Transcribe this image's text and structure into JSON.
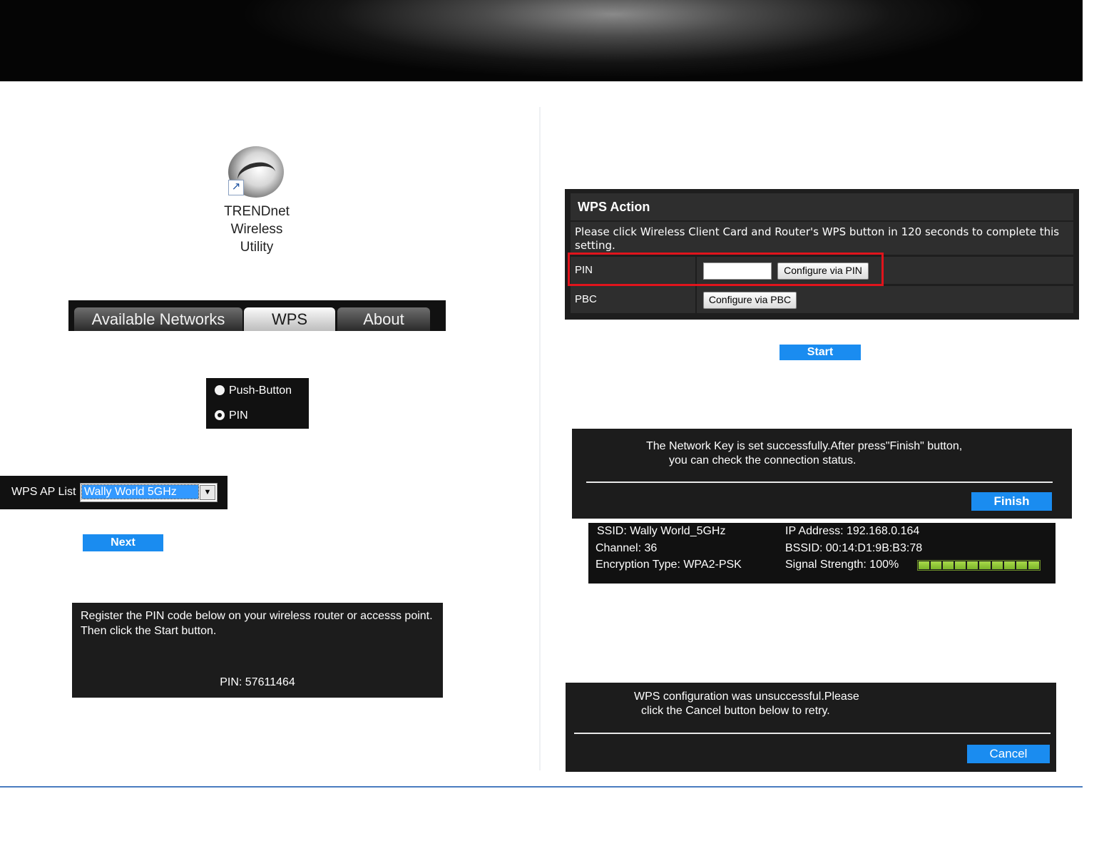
{
  "desktop_icon": {
    "label_line1": "TRENDnet",
    "label_line2": "Wireless",
    "label_line3": "Utility",
    "icon": "trendnet-logo-icon",
    "shortcut_icon": "shortcut-arrow-icon"
  },
  "tabs": [
    {
      "label": "Available Networks",
      "active": false
    },
    {
      "label": "WPS",
      "active": true
    },
    {
      "label": "About",
      "active": false
    }
  ],
  "wps_method": {
    "options": [
      "Push-Button",
      "PIN"
    ],
    "selected": "PIN"
  },
  "ap_list": {
    "label": "WPS AP List",
    "selected_value": "Wally World 5GHz"
  },
  "next_button": "Next",
  "pin_panel": {
    "message": "Register the PIN code below on your wireless router or accesss point.\nThen click the Start button.",
    "pin_text": "PIN: 57611464"
  },
  "wps_action": {
    "title": "WPS Action",
    "description": "Please click Wireless Client Card and Router's WPS button in 120 seconds to complete this setting.",
    "pin_label": "PIN",
    "pin_value": "",
    "pin_button": "Configure via PIN",
    "pbc_label": "PBC",
    "pbc_button": "Configure via PBC"
  },
  "start_button": "Start",
  "success_panel": {
    "line1": "The Network Key is set successfully.After press\"Finish\" button,",
    "line2": "you can check the connection status.",
    "button": "Finish"
  },
  "status": {
    "ssid": "SSID:  Wally World_5GHz",
    "channel": "Channel:  36",
    "encryption": "Encryption Type:  WPA2-PSK",
    "ip": "IP Address:  192.168.0.164",
    "bssid": "BSSID: 00:14:D1:9B:B3:78",
    "signal": "Signal Strength:   100%",
    "signal_fraction": 1.0
  },
  "fail_panel": {
    "line1": "WPS configuration was unsuccessful.Please",
    "line2": "click the Cancel button below to retry.",
    "button": "Cancel"
  },
  "colors": {
    "accent_blue": "#1a8cf0",
    "highlight_red": "#e0141c",
    "footer_rule": "#4a7cc0",
    "signal_green": "#8bc53a"
  }
}
